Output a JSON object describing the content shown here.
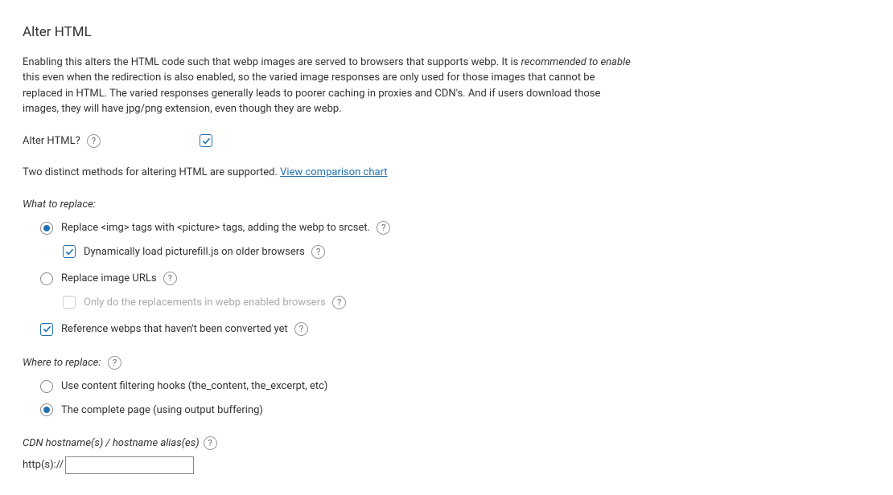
{
  "section": {
    "title": "Alter HTML"
  },
  "description": {
    "part1": "Enabling this alters the HTML code such that webp images are served to browsers that supports webp. It is ",
    "italic1": "recommended to enable",
    "part2": " this even when the redirection is also enabled, so the varied image responses are only used for those images that cannot be replaced in HTML. The varied responses generally leads to poorer caching in proxies and CDN's. And if users download those images, they will have jpg/png extension, even though they are webp."
  },
  "alterHtml": {
    "label": "Alter HTML?"
  },
  "methodsText": {
    "prefix": "Two distinct methods for altering HTML are supported. ",
    "link": "View comparison chart"
  },
  "whatToReplace": {
    "label": "What to replace:",
    "opt1": "Replace <img> tags with <picture> tags, adding the webp to srcset.",
    "opt1sub": "Dynamically load picturefill.js on older browsers",
    "opt2": "Replace image URLs",
    "opt2sub": "Only do the replacements in webp enabled browsers",
    "opt3": "Reference webps that haven't been converted yet"
  },
  "whereToReplace": {
    "label": "Where to replace:",
    "opt1": "Use content filtering hooks (the_content, the_excerpt, etc)",
    "opt2": "The complete page (using output buffering)"
  },
  "cdn": {
    "label": "CDN hostname(s) / hostname alias(es)",
    "prefix": "http(s)://",
    "value": ""
  }
}
